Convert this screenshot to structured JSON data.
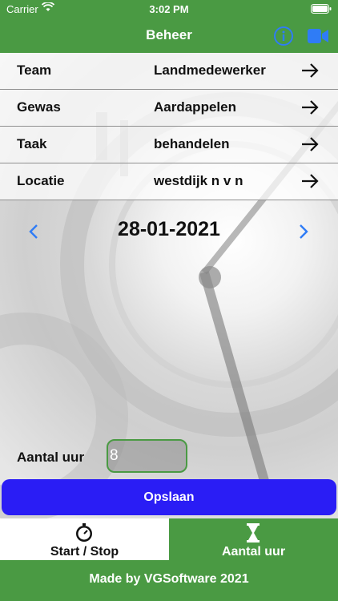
{
  "status": {
    "carrier": "Carrier",
    "time": "3:02 PM"
  },
  "nav": {
    "title": "Beheer",
    "info_icon": "info-icon",
    "video_icon": "video-camera-icon"
  },
  "rows": [
    {
      "label": "Team",
      "value": "Landmedewerker"
    },
    {
      "label": "Gewas",
      "value": "Aardappelen"
    },
    {
      "label": "Taak",
      "value": "behandelen"
    },
    {
      "label": "Locatie",
      "value": "westdijk n v n"
    }
  ],
  "date": {
    "value": "28-01-2021"
  },
  "hours": {
    "label": "Aantal uur",
    "value": "8"
  },
  "save_button": {
    "label": "Opslaan"
  },
  "tabs": [
    {
      "label": "Start / Stop",
      "icon": "stopwatch-icon",
      "selected": false
    },
    {
      "label": "Aantal uur",
      "icon": "hourglass-icon",
      "selected": true
    }
  ],
  "footer": {
    "text": "Made by VGSoftware 2021"
  },
  "colors": {
    "green": "#4a9a43",
    "save_blue": "#2a1df5",
    "accent_blue": "#2f7cf6"
  }
}
